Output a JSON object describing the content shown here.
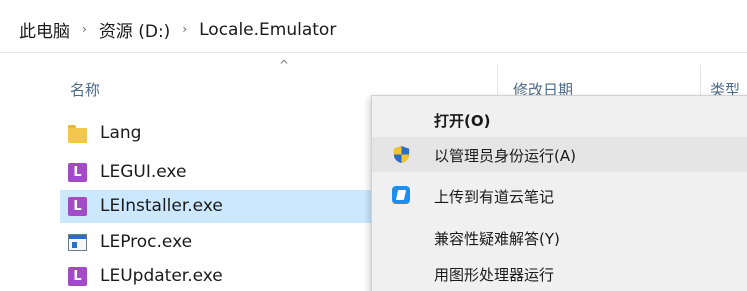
{
  "breadcrumb": {
    "items": [
      "此电脑",
      "资源 (D:)",
      "Locale.Emulator"
    ],
    "separator": "›"
  },
  "columns": {
    "name": "名称",
    "date": "修改日期",
    "type": "类型",
    "sort_indicator": "^"
  },
  "files": [
    {
      "name": "Lang",
      "icon": "folder-icon",
      "selected": false
    },
    {
      "name": "LEGUI.exe",
      "icon": "le-app-icon",
      "selected": false
    },
    {
      "name": "LEInstaller.exe",
      "icon": "le-app-icon",
      "selected": true
    },
    {
      "name": "LEProc.exe",
      "icon": "window-app-icon",
      "selected": false
    },
    {
      "name": "LEUpdater.exe",
      "icon": "le-app-icon",
      "selected": false
    }
  ],
  "context_menu": {
    "items": [
      {
        "label": "打开(O)",
        "bold": true,
        "icon": null,
        "hover": false
      },
      {
        "label": "以管理员身份运行(A)",
        "bold": false,
        "icon": "shield-icon",
        "hover": true
      },
      {
        "label": "上传到有道云笔记",
        "bold": false,
        "icon": "youdao-note-icon",
        "hover": false
      },
      {
        "label": "兼容性疑难解答(Y)",
        "bold": false,
        "icon": null,
        "hover": false
      },
      {
        "label": "用图形处理器运行",
        "bold": false,
        "icon": null,
        "hover": false
      }
    ]
  },
  "colors": {
    "selection": "#cce8ff",
    "header_text": "#4d6b8a",
    "le_icon": "#a24bc6",
    "menu_bg": "#f0f0f0",
    "menu_hover": "#e5e5e5"
  }
}
